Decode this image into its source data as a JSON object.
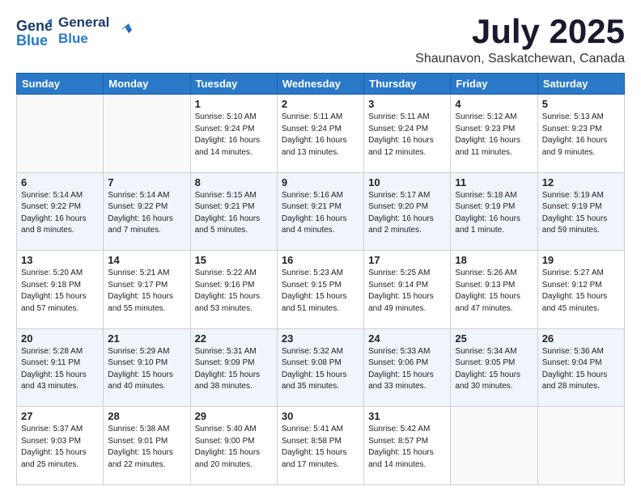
{
  "header": {
    "logo_line1": "General",
    "logo_line2": "Blue",
    "month": "July 2025",
    "location": "Shaunavon, Saskatchewan, Canada"
  },
  "weekdays": [
    "Sunday",
    "Monday",
    "Tuesday",
    "Wednesday",
    "Thursday",
    "Friday",
    "Saturday"
  ],
  "weeks": [
    [
      {
        "day": "",
        "info": ""
      },
      {
        "day": "",
        "info": ""
      },
      {
        "day": "1",
        "info": "Sunrise: 5:10 AM\nSunset: 9:24 PM\nDaylight: 16 hours\nand 14 minutes."
      },
      {
        "day": "2",
        "info": "Sunrise: 5:11 AM\nSunset: 9:24 PM\nDaylight: 16 hours\nand 13 minutes."
      },
      {
        "day": "3",
        "info": "Sunrise: 5:11 AM\nSunset: 9:24 PM\nDaylight: 16 hours\nand 12 minutes."
      },
      {
        "day": "4",
        "info": "Sunrise: 5:12 AM\nSunset: 9:23 PM\nDaylight: 16 hours\nand 11 minutes."
      },
      {
        "day": "5",
        "info": "Sunrise: 5:13 AM\nSunset: 9:23 PM\nDaylight: 16 hours\nand 9 minutes."
      }
    ],
    [
      {
        "day": "6",
        "info": "Sunrise: 5:14 AM\nSunset: 9:22 PM\nDaylight: 16 hours\nand 8 minutes."
      },
      {
        "day": "7",
        "info": "Sunrise: 5:14 AM\nSunset: 9:22 PM\nDaylight: 16 hours\nand 7 minutes."
      },
      {
        "day": "8",
        "info": "Sunrise: 5:15 AM\nSunset: 9:21 PM\nDaylight: 16 hours\nand 5 minutes."
      },
      {
        "day": "9",
        "info": "Sunrise: 5:16 AM\nSunset: 9:21 PM\nDaylight: 16 hours\nand 4 minutes."
      },
      {
        "day": "10",
        "info": "Sunrise: 5:17 AM\nSunset: 9:20 PM\nDaylight: 16 hours\nand 2 minutes."
      },
      {
        "day": "11",
        "info": "Sunrise: 5:18 AM\nSunset: 9:19 PM\nDaylight: 16 hours\nand 1 minute."
      },
      {
        "day": "12",
        "info": "Sunrise: 5:19 AM\nSunset: 9:19 PM\nDaylight: 15 hours\nand 59 minutes."
      }
    ],
    [
      {
        "day": "13",
        "info": "Sunrise: 5:20 AM\nSunset: 9:18 PM\nDaylight: 15 hours\nand 57 minutes."
      },
      {
        "day": "14",
        "info": "Sunrise: 5:21 AM\nSunset: 9:17 PM\nDaylight: 15 hours\nand 55 minutes."
      },
      {
        "day": "15",
        "info": "Sunrise: 5:22 AM\nSunset: 9:16 PM\nDaylight: 15 hours\nand 53 minutes."
      },
      {
        "day": "16",
        "info": "Sunrise: 5:23 AM\nSunset: 9:15 PM\nDaylight: 15 hours\nand 51 minutes."
      },
      {
        "day": "17",
        "info": "Sunrise: 5:25 AM\nSunset: 9:14 PM\nDaylight: 15 hours\nand 49 minutes."
      },
      {
        "day": "18",
        "info": "Sunrise: 5:26 AM\nSunset: 9:13 PM\nDaylight: 15 hours\nand 47 minutes."
      },
      {
        "day": "19",
        "info": "Sunrise: 5:27 AM\nSunset: 9:12 PM\nDaylight: 15 hours\nand 45 minutes."
      }
    ],
    [
      {
        "day": "20",
        "info": "Sunrise: 5:28 AM\nSunset: 9:11 PM\nDaylight: 15 hours\nand 43 minutes."
      },
      {
        "day": "21",
        "info": "Sunrise: 5:29 AM\nSunset: 9:10 PM\nDaylight: 15 hours\nand 40 minutes."
      },
      {
        "day": "22",
        "info": "Sunrise: 5:31 AM\nSunset: 9:09 PM\nDaylight: 15 hours\nand 38 minutes."
      },
      {
        "day": "23",
        "info": "Sunrise: 5:32 AM\nSunset: 9:08 PM\nDaylight: 15 hours\nand 35 minutes."
      },
      {
        "day": "24",
        "info": "Sunrise: 5:33 AM\nSunset: 9:06 PM\nDaylight: 15 hours\nand 33 minutes."
      },
      {
        "day": "25",
        "info": "Sunrise: 5:34 AM\nSunset: 9:05 PM\nDaylight: 15 hours\nand 30 minutes."
      },
      {
        "day": "26",
        "info": "Sunrise: 5:36 AM\nSunset: 9:04 PM\nDaylight: 15 hours\nand 28 minutes."
      }
    ],
    [
      {
        "day": "27",
        "info": "Sunrise: 5:37 AM\nSunset: 9:03 PM\nDaylight: 15 hours\nand 25 minutes."
      },
      {
        "day": "28",
        "info": "Sunrise: 5:38 AM\nSunset: 9:01 PM\nDaylight: 15 hours\nand 22 minutes."
      },
      {
        "day": "29",
        "info": "Sunrise: 5:40 AM\nSunset: 9:00 PM\nDaylight: 15 hours\nand 20 minutes."
      },
      {
        "day": "30",
        "info": "Sunrise: 5:41 AM\nSunset: 8:58 PM\nDaylight: 15 hours\nand 17 minutes."
      },
      {
        "day": "31",
        "info": "Sunrise: 5:42 AM\nSunset: 8:57 PM\nDaylight: 15 hours\nand 14 minutes."
      },
      {
        "day": "",
        "info": ""
      },
      {
        "day": "",
        "info": ""
      }
    ]
  ]
}
